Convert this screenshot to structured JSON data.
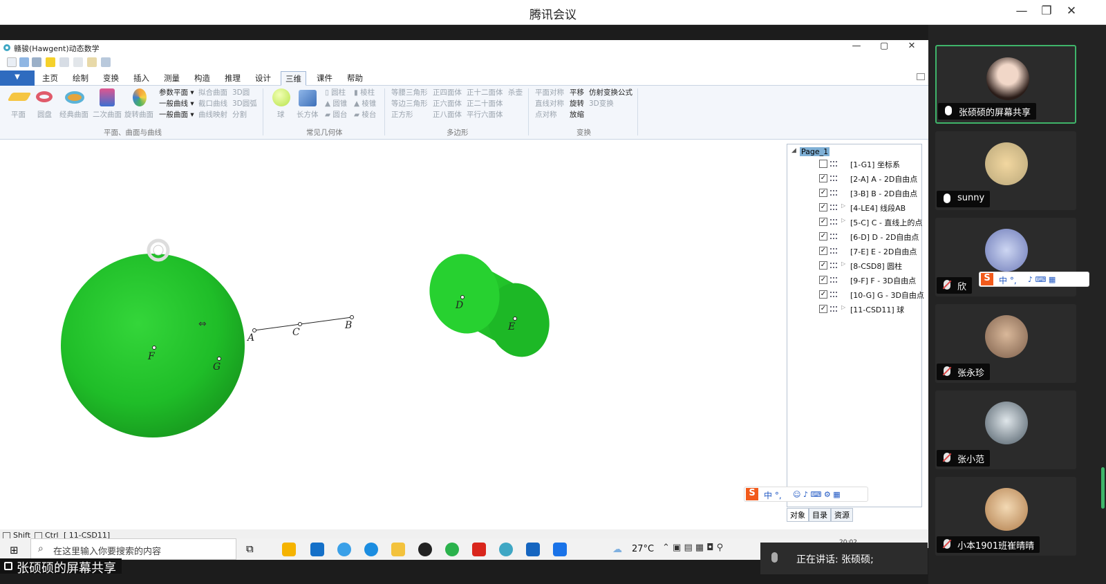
{
  "meeting": {
    "title": "腾讯会议",
    "speaking_label": "正在讲话: 张硕硕;",
    "share_tag": "张硕硕的屏幕共享"
  },
  "app": {
    "title": "赣骏(Hawgent)动态数学",
    "tabs": [
      "主页",
      "绘制",
      "变换",
      "插入",
      "测量",
      "构造",
      "推理",
      "设计",
      "三维",
      "课件",
      "帮助"
    ],
    "active_tab": "三维",
    "ribbon": {
      "group1": {
        "name": "平面、曲面与曲线",
        "big": [
          "平面",
          "圆盘",
          "经典曲面",
          "二次曲面",
          "旋转曲面"
        ],
        "menu": [
          "参数平面 ▾",
          "一般曲线 ▾",
          "一般曲面 ▾"
        ],
        "col2": [
          "拟合曲面",
          "截口曲线",
          "曲线映射"
        ],
        "col3": [
          "3D圆",
          "3D圆弧",
          "分割"
        ]
      },
      "group2": {
        "name": "常见几何体",
        "big": [
          "球",
          "长方体"
        ],
        "col1": [
          "圆柱",
          "圆锥",
          "圆台"
        ],
        "col2": [
          "棱柱",
          "棱锥",
          "棱台"
        ]
      },
      "group3": {
        "name": "多边形",
        "col1": [
          "等腰三角形",
          "等边三角形",
          "正方形"
        ],
        "col2": [
          "正四面体",
          "正六面体",
          "正八面体"
        ],
        "col3": [
          "正十二面体",
          "正二十面体",
          "平行六面体"
        ],
        "col4": [
          "杀壶"
        ]
      },
      "group4": {
        "name": "变换",
        "col1": [
          "平面对称",
          "直线对称",
          "点对称"
        ],
        "col2": [
          "平移",
          "旋转",
          "放缩"
        ],
        "col3": [
          "仿射变换公式",
          "3D变换"
        ]
      }
    },
    "canvas_labels": {
      "A": "A",
      "B": "B",
      "C": "C",
      "D": "D",
      "E": "E",
      "F": "F",
      "G": "G"
    },
    "tree": {
      "root": "Page_1",
      "items": [
        {
          "label": "[1-G1]  坐标系",
          "checked": false,
          "expand": false
        },
        {
          "label": "[2-A]  A - 2D自由点",
          "checked": true,
          "expand": false
        },
        {
          "label": "[3-B]  B - 2D自由点",
          "checked": true,
          "expand": false
        },
        {
          "label": "[4-LE4]  线段AB",
          "checked": true,
          "expand": true
        },
        {
          "label": "[5-C]  C - 直线上的点",
          "checked": true,
          "expand": true
        },
        {
          "label": "[6-D]  D - 2D自由点",
          "checked": true,
          "expand": false
        },
        {
          "label": "[7-E]  E - 2D自由点",
          "checked": true,
          "expand": false
        },
        {
          "label": "[8-CSD8]  圆柱",
          "checked": true,
          "expand": true
        },
        {
          "label": "[9-F]  F - 3D自由点",
          "checked": true,
          "expand": false
        },
        {
          "label": "[10-G]  G - 3D自由点",
          "checked": true,
          "expand": false
        },
        {
          "label": "[11-CSD11]  球",
          "checked": true,
          "expand": true
        }
      ],
      "tabs": [
        "对象",
        "目录",
        "资源"
      ]
    },
    "status": {
      "shift": "Shift",
      "ctrl": "Ctrl",
      "selection": "[ 11-CSD11]"
    }
  },
  "ime": {
    "label": "中 °,"
  },
  "taskbar": {
    "search_placeholder": "在这里输入你要搜索的内容",
    "weather": "27°C",
    "clock": "20:02"
  },
  "participants": [
    {
      "name": "张硕硕的屏幕共享",
      "muted": false,
      "share": true
    },
    {
      "name": "sunny",
      "muted": false
    },
    {
      "name": "欣",
      "muted": true
    },
    {
      "name": "张永珍",
      "muted": true
    },
    {
      "name": "张小范",
      "muted": true
    },
    {
      "name": "小本1901班崔晴晴",
      "muted": true
    }
  ],
  "colors": {
    "sphere": "#22c22a",
    "cylinder": "#22d02a",
    "active_tile": "#3fb56a"
  }
}
